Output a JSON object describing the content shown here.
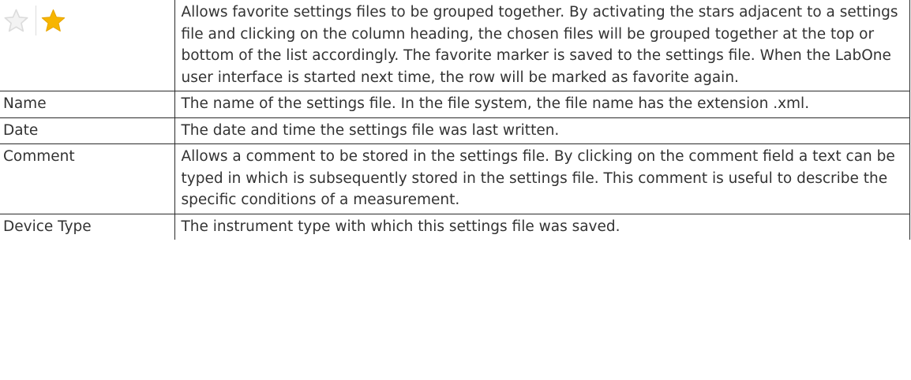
{
  "rows": [
    {
      "term": "",
      "term_icons": [
        "star-outline-icon",
        "star-filled-icon"
      ],
      "description": "Allows favorite settings files to be grouped together. By activating the stars adjacent to a settings file and clicking on the column heading, the chosen files will be grouped together at the top or bottom of the list accordingly. The favorite marker is saved to the settings file. When the LabOne user interface is started next time, the row will be marked as favorite again."
    },
    {
      "term": "Name",
      "description": "The name of the settings file. In the file system, the file name has the extension .xml."
    },
    {
      "term": "Date",
      "description": "The date and time the settings file was last written."
    },
    {
      "term": "Comment",
      "description": "Allows a comment to be stored in the settings file. By clicking on the comment field a text can be typed in which is subsequently stored in the settings file. This comment is useful to describe the specific conditions of a measurement."
    },
    {
      "term": "Device Type",
      "description": "The instrument type with which this settings file was saved."
    }
  ],
  "colors": {
    "star_filled": "#f7b500",
    "star_outline": "#e4e4e4",
    "border": "#2b2b2b",
    "text": "#333333"
  }
}
